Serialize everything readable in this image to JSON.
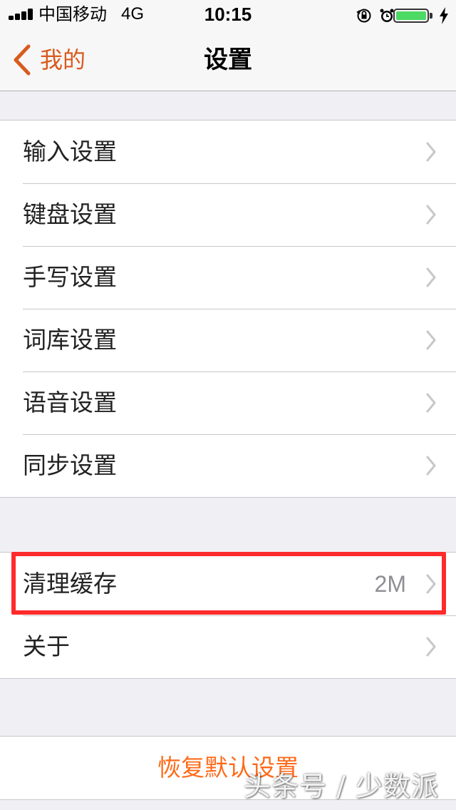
{
  "status_bar": {
    "carrier": "中国移动",
    "network": "4G",
    "time": "10:15",
    "battery_level": 1.0,
    "battery_color": "#4cd964"
  },
  "nav": {
    "back_label": "我的",
    "title": "设置",
    "accent_color": "#d95a1e"
  },
  "sections": {
    "main": [
      {
        "label": "输入设置"
      },
      {
        "label": "键盘设置"
      },
      {
        "label": "手写设置"
      },
      {
        "label": "词库设置"
      },
      {
        "label": "语音设置"
      },
      {
        "label": "同步设置"
      }
    ],
    "storage": [
      {
        "label": "清理缓存",
        "value": "2M"
      },
      {
        "label": "关于"
      }
    ]
  },
  "reset": {
    "label": "恢复默认设置",
    "color": "#ff6a1a"
  },
  "watermark": "头条号 / 少数派",
  "icons": [
    "signal-icon",
    "orientation-lock-icon",
    "alarm-icon",
    "battery-icon",
    "charging-icon",
    "back-chevron-icon",
    "chevron-right-icon"
  ]
}
